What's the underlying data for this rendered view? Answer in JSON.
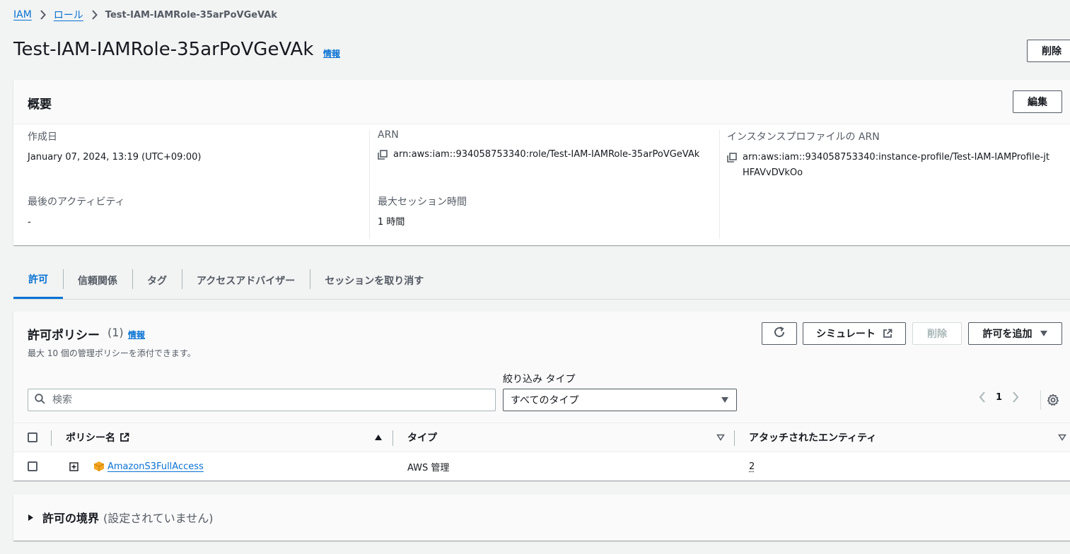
{
  "breadcrumb": {
    "items": [
      "IAM",
      "ロール"
    ],
    "current": "Test-IAM-IAMRole-35arPoVGeVAk"
  },
  "header": {
    "title": "Test-IAM-IAMRole-35arPoVGeVAk",
    "info": "情報",
    "delete_label": "削除"
  },
  "summary": {
    "title": "概要",
    "edit_label": "編集",
    "created_label": "作成日",
    "created_value": "January 07, 2024, 13:19 (UTC+09:00)",
    "last_activity_label": "最後のアクティビティ",
    "last_activity_value": "-",
    "arn_label": "ARN",
    "arn_value": "arn:aws:iam::934058753340:role/Test-IAM-IAMRole-35arPoVGeVAk",
    "max_session_label": "最大セッション時間",
    "max_session_value": "1 時間",
    "instance_profile_label": "インスタンスプロファイルの ARN",
    "instance_profile_value": "arn:aws:iam::934058753340:instance-profile/Test-IAM-IAMProfile-jtHFAVvDVkOo"
  },
  "tabs": [
    "許可",
    "信頼関係",
    "タグ",
    "アクセスアドバイザー",
    "セッションを取り消す"
  ],
  "permissions": {
    "title": "許可ポリシー",
    "count": "(1)",
    "info": "情報",
    "description": "最大 10 個の管理ポリシーを添付できます。",
    "simulate_label": "シミュレート",
    "delete_label": "削除",
    "add_label": "許可を追加",
    "filter_label": "絞り込み タイプ",
    "search_placeholder": "検索",
    "filter_value": "すべてのタイプ",
    "page": "1",
    "columns": [
      "ポリシー名",
      "タイプ",
      "アタッチされたエンティティ"
    ],
    "rows": [
      {
        "name": "AmazonS3FullAccess",
        "type": "AWS 管理",
        "entities": "2"
      }
    ]
  },
  "boundary": {
    "title": "許可の境界",
    "subtitle": "(設定されていません)"
  },
  "colors": {
    "link": "#0972d3",
    "background": "#f2f3f3",
    "policy_icon": "#f5a623"
  }
}
